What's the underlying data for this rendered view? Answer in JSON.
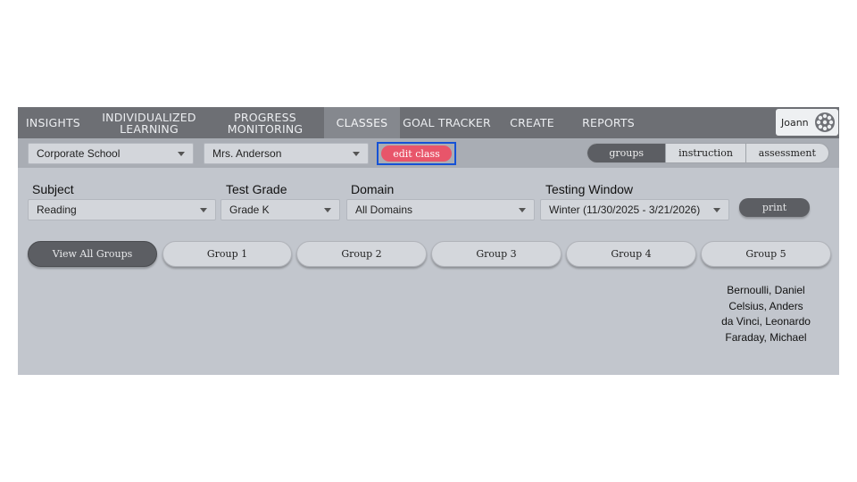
{
  "nav": {
    "items": [
      {
        "line1": "INSIGHTS",
        "line2": ""
      },
      {
        "line1": "INDIVIDUALIZED",
        "line2": "LEARNING"
      },
      {
        "line1": "PROGRESS",
        "line2": "MONITORING"
      },
      {
        "line1": "CLASSES",
        "line2": ""
      },
      {
        "line1": "GOAL TRACKER",
        "line2": ""
      },
      {
        "line1": "CREATE",
        "line2": ""
      },
      {
        "line1": "REPORTS",
        "line2": ""
      }
    ],
    "active": "CLASSES",
    "user_name": "Joann",
    "avatar_icon": "gear-avatar-icon"
  },
  "toolbar": {
    "school_select": "Corporate School",
    "teacher_select": "Mrs. Anderson",
    "edit_class_label": "edit class",
    "view_modes": [
      "groups",
      "instruction",
      "assessment"
    ],
    "active_mode": "groups"
  },
  "filters": {
    "subject_label": "Subject",
    "subject_value": "Reading",
    "grade_label": "Test Grade",
    "grade_value": "Grade K",
    "domain_label": "Domain",
    "domain_value": "All Domains",
    "window_label": "Testing Window",
    "window_value": "Winter (11/30/2025 - 3/21/2026)",
    "print_label": "print"
  },
  "groups": {
    "tabs": [
      "View All Groups",
      "Group 1",
      "Group 2",
      "Group 3",
      "Group 4",
      "Group 5"
    ],
    "active": "View All Groups"
  },
  "group5_students": [
    "Bernoulli, Daniel",
    "Celsius, Anders",
    "da Vinci, Leonardo",
    "Faraday, Michael"
  ],
  "colors": {
    "nav_bg": "#6d6f74",
    "edit_button": "#e8556a",
    "highlight_border": "#1552d6",
    "active_pill": "#5c5e63"
  }
}
